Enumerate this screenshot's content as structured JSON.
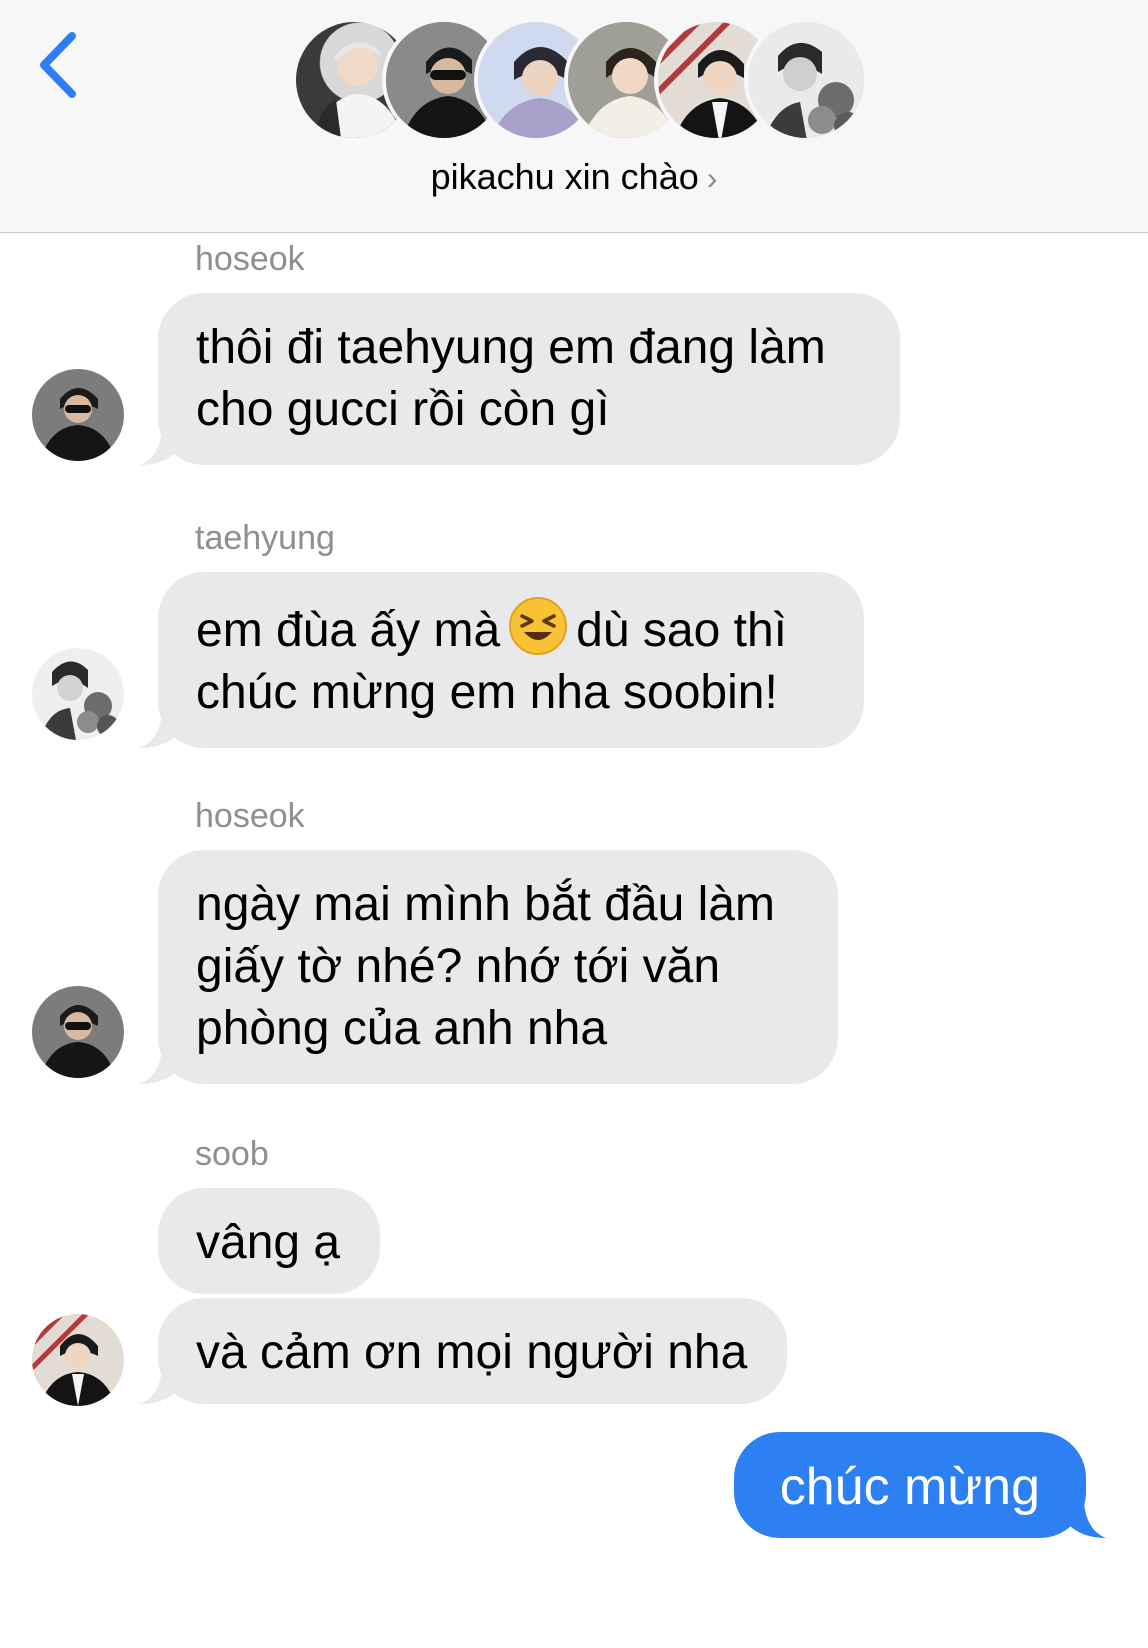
{
  "header": {
    "group_name": "pikachu xin chào",
    "chevron": "›",
    "back_icon": "chevron-left-icon",
    "accent": "#2f7cf6"
  },
  "members": [
    "member-1",
    "member-2",
    "member-3",
    "member-4",
    "member-5",
    "member-6"
  ],
  "messages": [
    {
      "sender": "hoseok",
      "lines": [
        "thôi đi taehyung em đang làm",
        "cho gucci rồi còn gì"
      ]
    },
    {
      "sender": "taehyung",
      "line1_a": "em đùa ấy mà",
      "line1_b": "dù sao thì",
      "line2": "chúc mừng em nha soobin!",
      "emoji": "squinting-laughing-face-icon"
    },
    {
      "sender": "hoseok",
      "lines": [
        "ngày mai mình bắt đầu làm",
        "giấy tờ nhé? nhớ tới văn",
        "phòng của anh nha"
      ]
    },
    {
      "sender": "soob",
      "bubbles": [
        "vâng ạ",
        "và cảm ơn mọi người nha"
      ]
    },
    {
      "sender": "me",
      "text": "chúc mừng"
    }
  ],
  "colors": {
    "incoming_bubble": "#e9e9eb",
    "outgoing_bubble": "#2c80f2",
    "sender_label": "#8e8e93"
  }
}
